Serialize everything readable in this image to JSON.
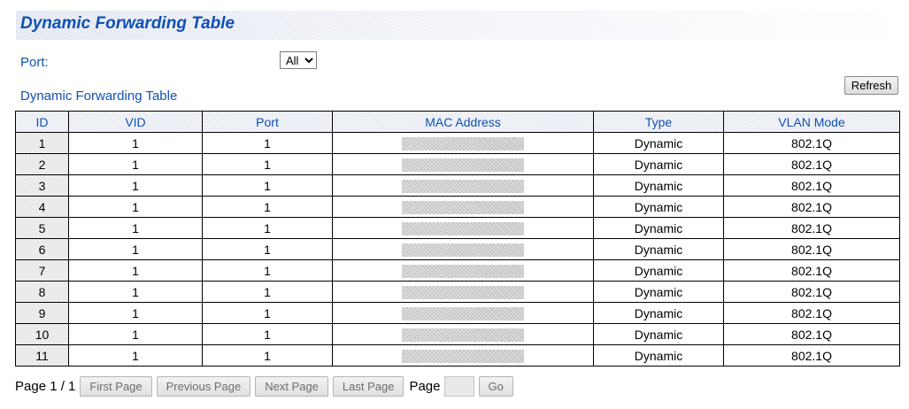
{
  "header": {
    "title": "Dynamic Forwarding Table"
  },
  "filter": {
    "port_label": "Port:",
    "port_options": [
      "All"
    ],
    "port_selected": "All"
  },
  "section": {
    "title": "Dynamic Forwarding Table"
  },
  "toolbar": {
    "refresh_label": "Refresh"
  },
  "table": {
    "columns": [
      "ID",
      "VID",
      "Port",
      "MAC Address",
      "Type",
      "VLAN Mode"
    ],
    "rows": [
      {
        "id": "1",
        "vid": "1",
        "port": "1",
        "mac": "",
        "type": "Dynamic",
        "vlan_mode": "802.1Q"
      },
      {
        "id": "2",
        "vid": "1",
        "port": "1",
        "mac": "",
        "type": "Dynamic",
        "vlan_mode": "802.1Q"
      },
      {
        "id": "3",
        "vid": "1",
        "port": "1",
        "mac": "",
        "type": "Dynamic",
        "vlan_mode": "802.1Q"
      },
      {
        "id": "4",
        "vid": "1",
        "port": "1",
        "mac": "",
        "type": "Dynamic",
        "vlan_mode": "802.1Q"
      },
      {
        "id": "5",
        "vid": "1",
        "port": "1",
        "mac": "",
        "type": "Dynamic",
        "vlan_mode": "802.1Q"
      },
      {
        "id": "6",
        "vid": "1",
        "port": "1",
        "mac": "",
        "type": "Dynamic",
        "vlan_mode": "802.1Q"
      },
      {
        "id": "7",
        "vid": "1",
        "port": "1",
        "mac": "",
        "type": "Dynamic",
        "vlan_mode": "802.1Q"
      },
      {
        "id": "8",
        "vid": "1",
        "port": "1",
        "mac": "",
        "type": "Dynamic",
        "vlan_mode": "802.1Q"
      },
      {
        "id": "9",
        "vid": "1",
        "port": "1",
        "mac": "",
        "type": "Dynamic",
        "vlan_mode": "802.1Q"
      },
      {
        "id": "10",
        "vid": "1",
        "port": "1",
        "mac": "",
        "type": "Dynamic",
        "vlan_mode": "802.1Q"
      },
      {
        "id": "11",
        "vid": "1",
        "port": "1",
        "mac": "",
        "type": "Dynamic",
        "vlan_mode": "802.1Q"
      }
    ]
  },
  "pager": {
    "page_info": "Page 1 / 1",
    "first_label": "First Page",
    "previous_label": "Previous Page",
    "next_label": "Next Page",
    "last_label": "Last Page",
    "goto_label": "Page",
    "page_input_value": "",
    "go_label": "Go"
  },
  "colors": {
    "accent_text": "#1050b4",
    "header_bg": "#e8ebf3",
    "id_cell_bg": "#e6e6e6",
    "disabled_text": "#6e6e6e"
  }
}
